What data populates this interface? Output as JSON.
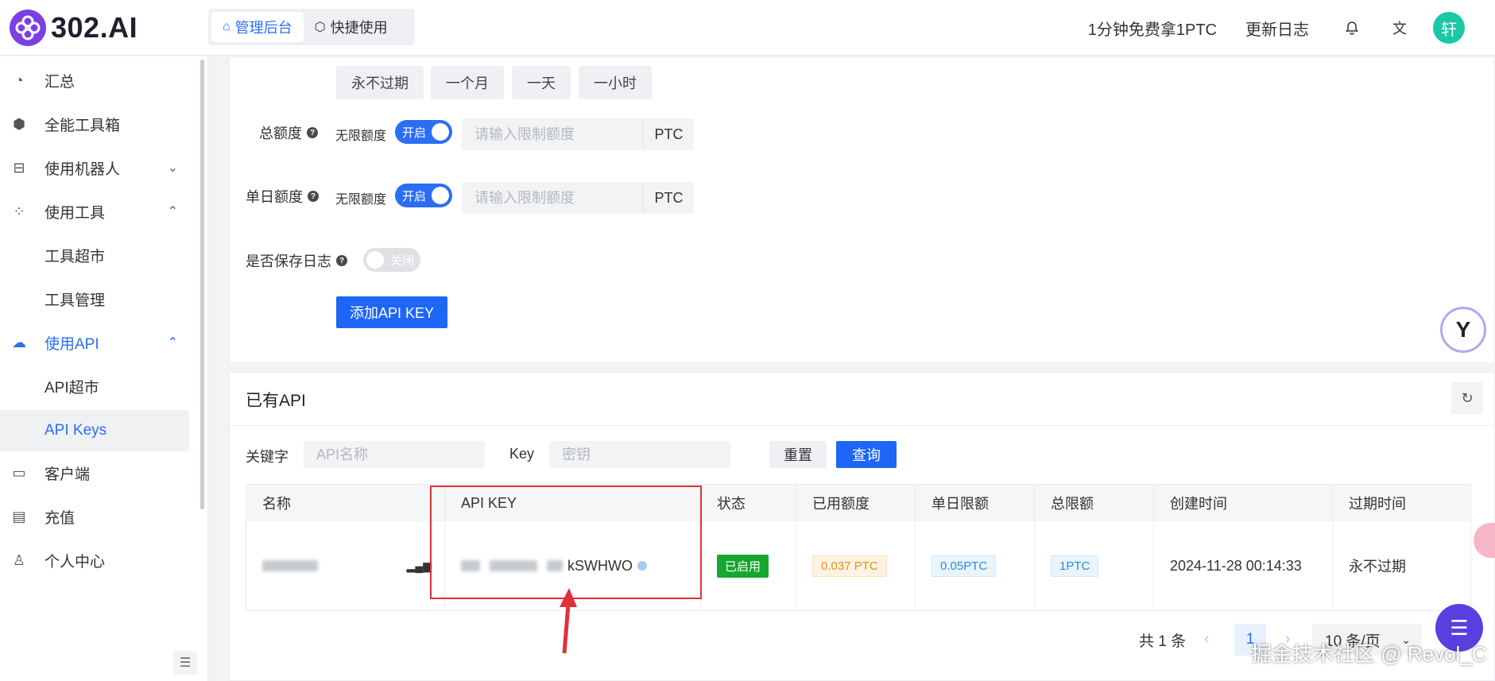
{
  "brand": {
    "name": "302.AI",
    "logo_icon": "clover-logo-icon"
  },
  "header": {
    "modes": [
      {
        "label": "管理后台",
        "icon": "home-icon",
        "active": true
      },
      {
        "label": "快捷使用",
        "icon": "cube-icon",
        "active": false
      }
    ],
    "promo_link": "1分钟免费拿1PTC",
    "changelog_link": "更新日志",
    "avatar_text": "轩"
  },
  "sidebar": {
    "items": [
      {
        "label": "汇总",
        "icon": "dashboard-icon"
      },
      {
        "label": "全能工具箱",
        "icon": "box-icon"
      },
      {
        "label": "使用机器人",
        "icon": "robot-icon",
        "chevron": "⌄"
      },
      {
        "label": "使用工具",
        "icon": "tools-icon",
        "chevron": "⌃"
      },
      {
        "label": "工具超市",
        "sub": true
      },
      {
        "label": "工具管理",
        "sub": true
      },
      {
        "label": "使用API",
        "icon": "cloud-api-icon",
        "chevron": "⌃",
        "active_group": true
      },
      {
        "label": "API超市",
        "sub": true
      },
      {
        "label": "API Keys",
        "sub": true,
        "selected": true
      },
      {
        "label": "客户端",
        "icon": "monitor-icon"
      },
      {
        "label": "充值",
        "icon": "card-icon"
      },
      {
        "label": "个人中心",
        "icon": "user-icon"
      }
    ]
  },
  "form": {
    "expiry_options": [
      "永不过期",
      "一个月",
      "一天",
      "一小时"
    ],
    "total_quota": {
      "label": "总额度",
      "unlimited_label": "无限额度",
      "switch_text": "开启",
      "placeholder": "请输入限制额度",
      "unit": "PTC"
    },
    "daily_quota": {
      "label": "单日额度",
      "unlimited_label": "无限额度",
      "switch_text": "开启",
      "placeholder": "请输入限制额度",
      "unit": "PTC"
    },
    "save_log": {
      "label": "是否保存日志",
      "switch_text": "关闭"
    },
    "add_button": "添加API KEY"
  },
  "existing": {
    "title": "已有API",
    "keyword_label": "关键字",
    "keyword_placeholder": "API名称",
    "key_label": "Key",
    "key_placeholder": "密钥",
    "reset_button": "重置",
    "query_button": "查询",
    "columns": [
      "名称",
      "API KEY",
      "状态",
      "已用额度",
      "单日限额",
      "总限额",
      "创建时间",
      "过期时间"
    ],
    "rows": [
      {
        "api_key_suffix": "kSWHWO",
        "status": "已启用",
        "used": "0.037 PTC",
        "daily_limit": "0.05PTC",
        "total_limit": "1PTC",
        "created_at": "2024-11-28 00:14:33",
        "expires": "永不过期"
      }
    ],
    "pagination": {
      "total": "共 1 条",
      "current_page": "1",
      "page_size": "10 条/页"
    }
  },
  "watermark": "掘金技术社区 @ Revol_C",
  "colors": {
    "primary": "#1e66f5",
    "brand": "#7b3fe4",
    "success": "#15a72e",
    "avatar": "#1bc8a6"
  }
}
